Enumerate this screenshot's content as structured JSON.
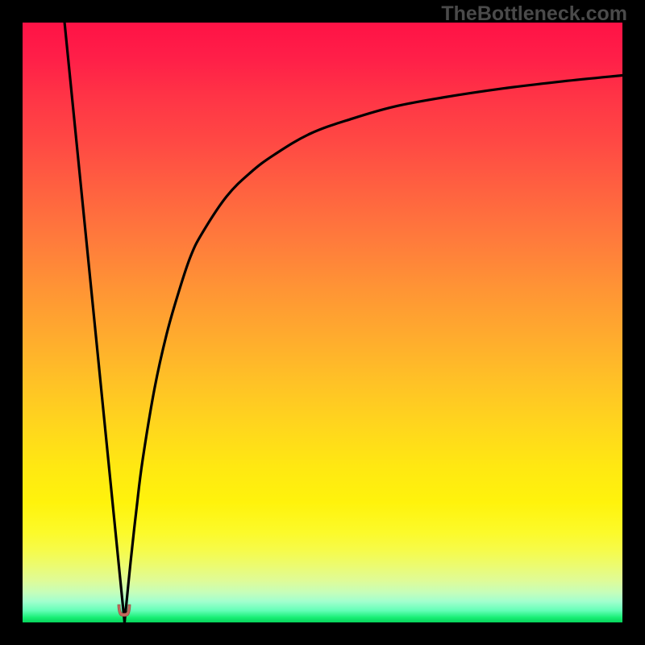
{
  "watermark": "TheBottleneck.com",
  "colors": {
    "frame": "#000000",
    "curve": "#000000",
    "notch_fill": "#c26a5c",
    "gradient_top": "#ff1246",
    "gradient_mid": "#fff30c",
    "gradient_bottom": "#06d35b"
  },
  "chart_data": {
    "type": "line",
    "title": "",
    "xlabel": "",
    "ylabel": "",
    "xlim": [
      0,
      100
    ],
    "ylim": [
      0,
      100
    ],
    "grid": false,
    "legend": false,
    "annotations": [
      {
        "text": "TheBottleneck.com",
        "pos": "top-right"
      }
    ],
    "minimum_marker": {
      "x": 17,
      "y": 0
    },
    "series": [
      {
        "name": "left-branch",
        "x": [
          7,
          8,
          9,
          10,
          11,
          12,
          13,
          14,
          15,
          16,
          17
        ],
        "y": [
          100,
          90,
          80,
          70,
          60,
          50,
          40,
          30,
          20,
          10,
          0
        ]
      },
      {
        "name": "right-branch",
        "x": [
          17,
          18,
          19,
          20,
          22,
          24,
          26,
          28,
          30,
          34,
          38,
          42,
          48,
          55,
          62,
          70,
          80,
          90,
          100
        ],
        "y": [
          0,
          10,
          19,
          27,
          39,
          48,
          55,
          61,
          65,
          71,
          75,
          78,
          81.5,
          84,
          86,
          87.5,
          89,
          90.2,
          91.2
        ]
      }
    ],
    "background_gradient": {
      "0": "#ff1246",
      "50": "#ffaa2e",
      "80": "#fff30c",
      "95": "#c6feba",
      "100": "#06d35b"
    }
  }
}
